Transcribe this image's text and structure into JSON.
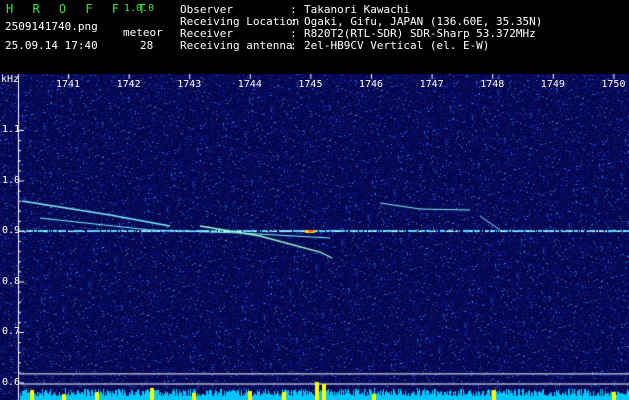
{
  "app": {
    "title": "H R O F F T",
    "version": "1.0.0",
    "filename": "2509141740.png",
    "datetime": "25.09.14 17:40",
    "meteor_label": "meteor",
    "meteor_count": "28"
  },
  "info": [
    {
      "label": "Observer",
      "value": "Takanori Kawachi"
    },
    {
      "label": "Receiving Location",
      "value": "Ogaki, Gifu, JAPAN (136.60E, 35.35N)"
    },
    {
      "label": "Receiver",
      "value": "R820T2(RTL-SDR) SDR-Sharp 53.372MHz"
    },
    {
      "label": "Receiving antenna",
      "value": "2el-HB9CV Vertical (el. E-W)"
    }
  ],
  "spectrogram": {
    "y_unit": "kHz",
    "y_ticks": [
      "1.1",
      "1.0",
      "0.9",
      "0.8",
      "0.7",
      "0.6"
    ],
    "x_ticks": [
      "1741",
      "1742",
      "1743",
      "1744",
      "1745",
      "1746",
      "1747",
      "1748",
      "1749",
      "1750"
    ],
    "ylim": [
      0.58,
      1.17
    ],
    "carrier_khz": 0.9,
    "colors": {
      "background": "#06064a",
      "grid": "#ffffff",
      "carrier": "#5ad6ff",
      "echo": "#7cf0ff",
      "strong_echo": "#ffd000",
      "counter_bar": "#00c8ff",
      "counter_peak": "#ffff00"
    }
  }
}
